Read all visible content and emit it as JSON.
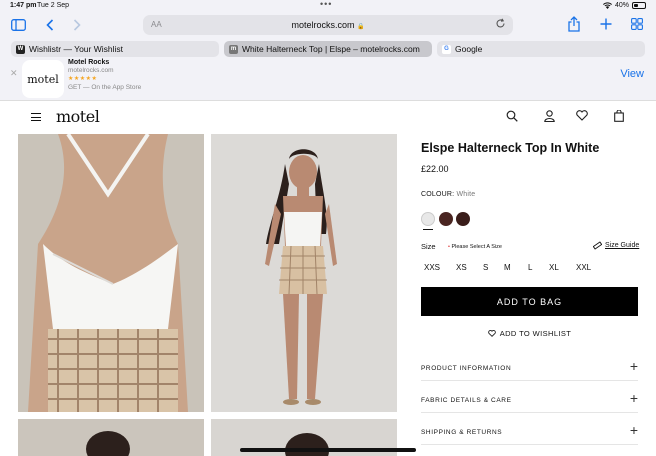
{
  "status": {
    "time": "1:47 pm",
    "date": "Tue 2 Sep",
    "battery": "40%",
    "battery_level": 0.4
  },
  "toolbar": {
    "text_size_label": "AA",
    "url": "motelrocks.com",
    "icons": [
      "sidebar-icon",
      "back-icon",
      "forward-icon",
      "reload-icon",
      "share-icon",
      "new-tab-icon",
      "tabs-overview-icon"
    ]
  },
  "tabs": [
    {
      "label": "Wishlistr — Your Wishlist",
      "active": false
    },
    {
      "label": "White Halterneck Top | Elspe – motelrocks.com",
      "active": true
    },
    {
      "label": "Google",
      "active": false
    }
  ],
  "banner": {
    "app_icon_text": "motel",
    "title": "Motel Rocks",
    "subtitle": "motelrocks.com",
    "stars": "★★★★★",
    "get_text": "GET — On the App Store",
    "view_label": "View"
  },
  "site": {
    "logo": "motel"
  },
  "product": {
    "title": "Elspe Halterneck Top In White",
    "price": "£22.00",
    "colour_label": "COLOUR:",
    "colour_value": "White",
    "swatches": [
      {
        "name": "White",
        "color": "#e8e8e8"
      },
      {
        "name": "Brown",
        "color": "#4a2521"
      },
      {
        "name": "Dark Brown",
        "color": "#3a1d1a"
      }
    ],
    "size_label": "Size",
    "size_note": "Please Select A Size",
    "size_guide": "Size Guide",
    "sizes": [
      "XXS",
      "XS",
      "S",
      "M",
      "L",
      "XL",
      "XXL"
    ],
    "add_to_bag": "ADD TO BAG",
    "add_to_wishlist": "ADD TO WISHLIST",
    "accordions": [
      "PRODUCT INFORMATION",
      "FABRIC DETAILS & CARE",
      "SHIPPING & RETURNS"
    ]
  }
}
